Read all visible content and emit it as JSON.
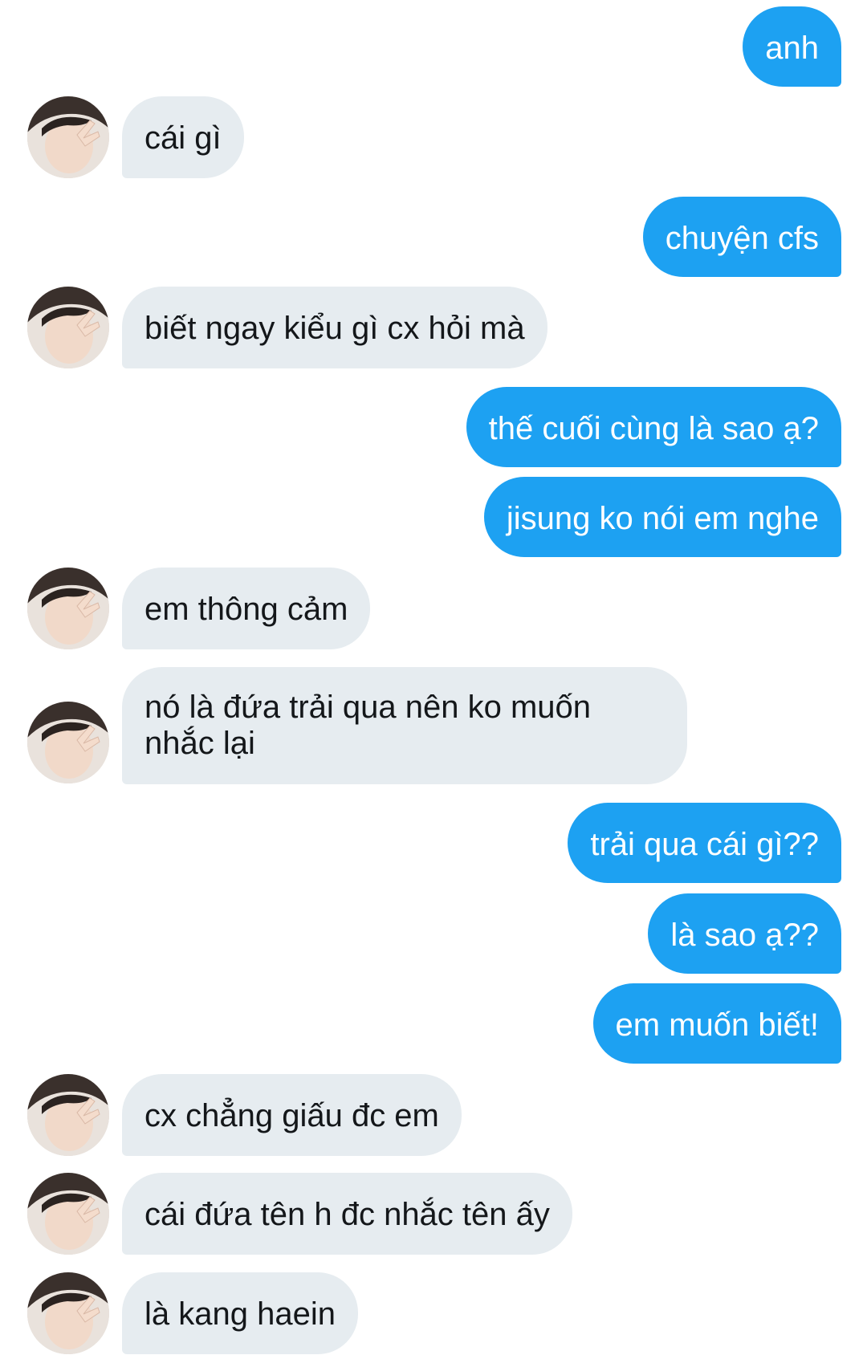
{
  "conversation": {
    "messages": [
      {
        "side": "out",
        "text": "anh"
      },
      {
        "side": "in",
        "text": "cái gì"
      },
      {
        "side": "out",
        "text": "chuyện cfs"
      },
      {
        "side": "in",
        "text": "biết ngay kiểu gì cx hỏi mà"
      },
      {
        "side": "out",
        "text": "thế cuối cùng là sao ạ?"
      },
      {
        "side": "out",
        "text": "jisung ko nói em nghe"
      },
      {
        "side": "in",
        "text": "em thông cảm"
      },
      {
        "side": "in",
        "text": "nó là đứa trải qua nên ko muốn nhắc lại"
      },
      {
        "side": "out",
        "text": "trải qua cái gì??"
      },
      {
        "side": "out",
        "text": "là sao ạ??"
      },
      {
        "side": "out",
        "text": "em muốn biết!"
      },
      {
        "side": "in",
        "text": "cx chẳng giấu đc em"
      },
      {
        "side": "in",
        "text": "cái đứa tên h đc nhắc tên ấy"
      },
      {
        "side": "in",
        "text": "là kang haein"
      }
    ]
  },
  "colors": {
    "outgoing_bubble": "#1da1f2",
    "incoming_bubble": "#e6ecf0",
    "outgoing_text": "#ffffff",
    "incoming_text": "#14171a"
  },
  "icons": {
    "avatar": "contact-avatar-photo"
  }
}
